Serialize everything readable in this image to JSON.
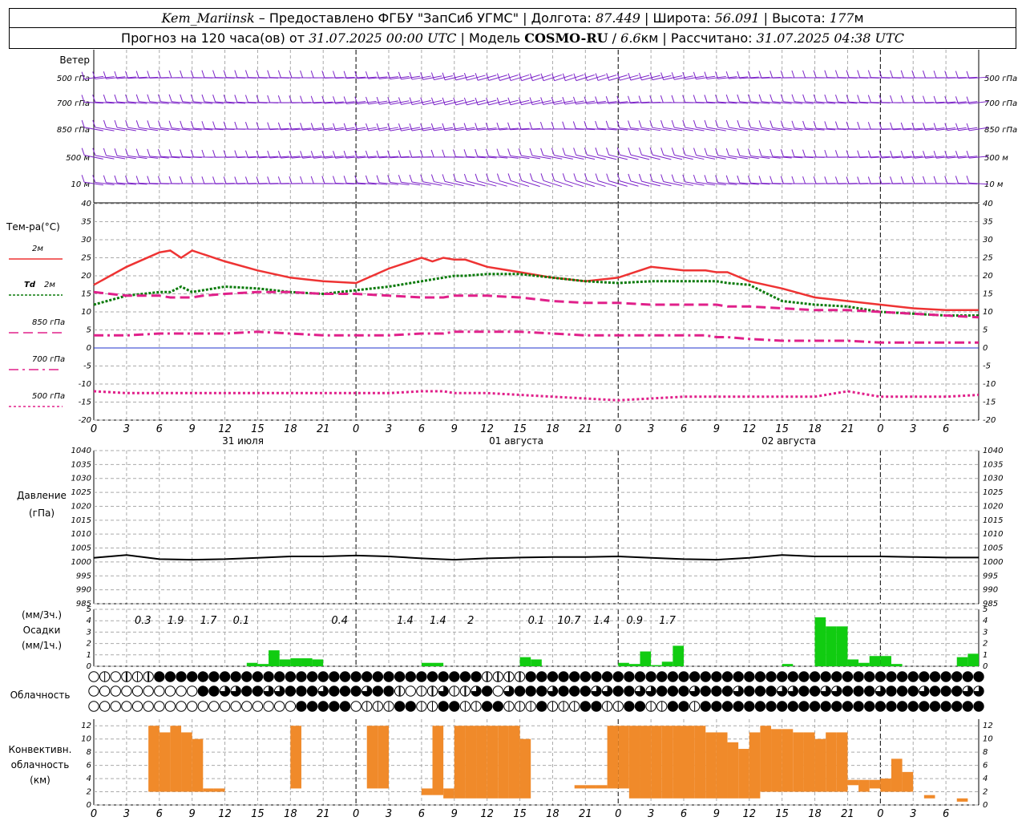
{
  "header": {
    "station": "Kem_Mariinsk",
    "dash": "–",
    "provider": "Предоставлено ФГБУ \"ЗапСиб УГМС\"",
    "lon_label": "Долгота:",
    "lon_value": "87.449",
    "lat_label": "Широта:",
    "lat_value": "56.091",
    "alt_label": "Высота:",
    "alt_value": "177",
    "alt_unit": "м",
    "forecast_prefix": "Прогноз на 120 часа(ов) от",
    "forecast_time": "31.07.2025 00:00 UTC",
    "model_label": "Модель",
    "model_name": "COSMO-RU",
    "model_res": "6.6",
    "model_res_unit": "км",
    "calc_label": "Рассчитано:",
    "calc_time": "31.07.2025 04:38 UTC"
  },
  "wind": {
    "title": "Ветер",
    "levels": [
      "500 гПа",
      "700 гПа",
      "850 гПа",
      "500 м",
      "10 м"
    ],
    "right_levels": [
      "500 гПа",
      "700 гПа",
      "850 гПа",
      "500 м",
      "10 м"
    ],
    "color": "#7b22c8"
  },
  "temperature": {
    "title": "Тем-ра(°C)",
    "legend": [
      {
        "label": "2м",
        "italic": "",
        "color": "#ee3333",
        "style": "solid"
      },
      {
        "label": "2м",
        "italic": "Td",
        "color": "#0a7a0a",
        "style": "dotted"
      },
      {
        "label": "850 гПа",
        "italic": "",
        "color": "#e0208a",
        "style": "dashed"
      },
      {
        "label": "700 гПа",
        "italic": "",
        "color": "#e0208a",
        "style": "dashdot"
      },
      {
        "label": "500 гПа",
        "italic": "",
        "color": "#e0208a",
        "style": "dot"
      }
    ],
    "y_ticks": [
      "40",
      "35",
      "30",
      "25",
      "20",
      "15",
      "10",
      "5",
      "0",
      "-5",
      "-10",
      "-15",
      "-20"
    ]
  },
  "time_axis": {
    "hour_labels": [
      "0",
      "3",
      "6",
      "9",
      "12",
      "15",
      "18",
      "21",
      "0",
      "3",
      "6",
      "9",
      "12",
      "15",
      "18",
      "21",
      "0",
      "3",
      "6",
      "9",
      "12",
      "15",
      "18",
      "21",
      "0",
      "3",
      "6"
    ],
    "dates": [
      "31 июля",
      "01 августа",
      "02 августа"
    ]
  },
  "pressure": {
    "title_line1": "Давление",
    "title_line2": "(гПа)",
    "y_ticks": [
      "1040",
      "1035",
      "1030",
      "1025",
      "1020",
      "1015",
      "1010",
      "1005",
      "1000",
      "995",
      "990",
      "985"
    ]
  },
  "precip": {
    "title_line1": "(мм/3ч.)",
    "title_line2": "Осадки",
    "title_line3": "(мм/1ч.)",
    "y_ticks": [
      "5",
      "4",
      "3",
      "2",
      "1",
      "0"
    ],
    "labels": [
      {
        "hour": 4.5,
        "text": "0.3"
      },
      {
        "hour": 7.5,
        "text": "1.9"
      },
      {
        "hour": 10.5,
        "text": "1.7"
      },
      {
        "hour": 13.5,
        "text": "0.1"
      },
      {
        "hour": 22.5,
        "text": "0.4"
      },
      {
        "hour": 28.5,
        "text": "1.4"
      },
      {
        "hour": 31.5,
        "text": "1.4"
      },
      {
        "hour": 34.5,
        "text": "2"
      },
      {
        "hour": 40.5,
        "text": "0.1"
      },
      {
        "hour": 43.5,
        "text": "10.7"
      },
      {
        "hour": 46.5,
        "text": "1.4"
      },
      {
        "hour": 49.5,
        "text": "0.9"
      },
      {
        "hour": 52.5,
        "text": "1.7"
      }
    ],
    "color": "#11cc11"
  },
  "cloudiness": {
    "title": "Облачность",
    "rows": 3
  },
  "convective": {
    "title_line1": "Конвективн.",
    "title_line2": "облачность",
    "title_line3": "(км)",
    "y_ticks": [
      "12",
      "10",
      "8",
      "6",
      "4",
      "2",
      "0"
    ],
    "color": "#f08a2a"
  },
  "chart_data": [
    {
      "type": "line",
      "title": "Тем-ра(°C)",
      "xlabel": "",
      "ylabel": "Тем-ра(°C)",
      "x_hours": [
        0,
        3,
        6,
        7,
        8,
        9,
        10,
        12,
        15,
        18,
        21,
        24,
        27,
        30,
        31,
        32,
        33,
        34,
        36,
        39,
        42,
        45,
        48,
        51,
        54,
        55,
        56,
        57,
        58,
        60,
        63,
        66,
        69,
        72,
        75,
        78,
        81
      ],
      "ylim": [
        -20,
        40
      ],
      "series": [
        {
          "name": "2м",
          "values": [
            17.5,
            22.5,
            26.5,
            27,
            25,
            27,
            26,
            24,
            21.5,
            19.5,
            18.5,
            18,
            22,
            25,
            24,
            25,
            24.5,
            24.5,
            22.5,
            21,
            19.5,
            18.5,
            19.5,
            22.5,
            21.5,
            21.5,
            21.5,
            21,
            21,
            18.5,
            16.5,
            14,
            13,
            12,
            11,
            10.5,
            10.5
          ]
        },
        {
          "name": "Td 2м",
          "values": [
            12,
            14.5,
            15.5,
            15.5,
            17,
            15.5,
            16,
            17,
            16.5,
            15.5,
            15,
            16,
            17,
            18.5,
            19,
            19.5,
            20,
            20,
            20.5,
            20.5,
            19.5,
            18.5,
            18,
            18.5,
            18.5,
            18.5,
            18.5,
            18.5,
            18,
            17.5,
            13,
            12,
            11.5,
            10,
            9.5,
            9,
            9
          ]
        },
        {
          "name": "850 гПа",
          "values": [
            15.5,
            14.5,
            14.5,
            14,
            14,
            14,
            14.5,
            15,
            15.5,
            15.5,
            15,
            15,
            14.5,
            14,
            14,
            14,
            14.5,
            14.5,
            14.5,
            14,
            13,
            12.5,
            12.5,
            12,
            12,
            12,
            12,
            12,
            11.5,
            11.5,
            11,
            10.5,
            10.5,
            10,
            9.5,
            9,
            8.5
          ]
        },
        {
          "name": "700 гПа",
          "values": [
            3.5,
            3.5,
            4,
            4,
            4,
            4,
            4,
            4,
            4.5,
            4,
            3.5,
            3.5,
            3.5,
            4,
            4,
            4,
            4.5,
            4.5,
            4.5,
            4.5,
            4,
            3.5,
            3.5,
            3.5,
            3.5,
            3.5,
            3.5,
            3,
            3,
            2.5,
            2,
            2,
            2,
            1.5,
            1.5,
            1.5,
            1.5
          ]
        },
        {
          "name": "500 гПа",
          "values": [
            -12,
            -12.5,
            -12.5,
            -12.5,
            -12.5,
            -12.5,
            -12.5,
            -12.5,
            -12.5,
            -12.5,
            -12.5,
            -12.5,
            -12.5,
            -12,
            -12,
            -12,
            -12.5,
            -12.5,
            -12.5,
            -13,
            -13.5,
            -14,
            -14.5,
            -14,
            -13.5,
            -13.5,
            -13.5,
            -13.5,
            -13.5,
            -13.5,
            -13.5,
            -13.5,
            -12,
            -13.5,
            -13.5,
            -13.5,
            -13
          ]
        }
      ]
    },
    {
      "type": "line",
      "title": "Давление (гПа)",
      "xlabel": "",
      "ylabel": "Давление (гПа)",
      "x_hours": [
        0,
        3,
        6,
        9,
        12,
        15,
        18,
        21,
        24,
        27,
        30,
        33,
        36,
        39,
        42,
        45,
        48,
        51,
        54,
        57,
        60,
        63,
        66,
        69,
        72,
        75,
        78,
        81
      ],
      "ylim": [
        985,
        1040
      ],
      "series": [
        {
          "name": "Давление",
          "values": [
            1001.5,
            1002.5,
            1001,
            1000.8,
            1001,
            1001.5,
            1002,
            1002,
            1002.3,
            1002,
            1001.3,
            1000.8,
            1001.3,
            1001.6,
            1001.8,
            1001.8,
            1002,
            1001.5,
            1001,
            1000.8,
            1001.5,
            1002.5,
            1002,
            1002,
            1002,
            1001.8,
            1001.6,
            1001.6
          ]
        }
      ]
    },
    {
      "type": "bar",
      "title": "Осадки (мм/1ч.)",
      "xlabel": "",
      "ylabel": "Осадки",
      "ylim": [
        0,
        5
      ],
      "x_hours": [
        15,
        16,
        17,
        18,
        19,
        20,
        21,
        22,
        23,
        31,
        32,
        40,
        41,
        49,
        50,
        51,
        52,
        53,
        54,
        55,
        56,
        57,
        64,
        65,
        66,
        67,
        68,
        69,
        70,
        71,
        72,
        73,
        74,
        75,
        76,
        77,
        80,
        81
      ],
      "values": [
        0.3,
        0.2,
        1.4,
        0.6,
        0.7,
        0.7,
        0.6,
        0,
        0,
        0.3,
        0.3,
        0.8,
        0.6,
        0.3,
        0.2,
        1.3,
        0.1,
        0.4,
        1.8,
        0,
        0,
        0,
        0.2,
        0,
        0,
        4.3,
        3.5,
        3.5,
        0.6,
        0.3,
        0.9,
        0.9,
        0.2,
        0,
        0,
        0,
        0.8,
        1.1
      ]
    },
    {
      "type": "bar",
      "title": "Конвективн. облачность (км)",
      "xlabel": "",
      "ylabel": "(км)",
      "ylim": [
        0,
        13
      ],
      "x_hours": [
        6,
        7,
        8,
        9,
        10,
        11,
        12,
        13,
        16,
        17,
        19,
        22,
        23,
        24,
        25,
        26,
        27,
        29,
        30,
        31,
        32,
        33,
        34,
        35,
        36,
        37,
        38,
        39,
        40,
        44,
        45,
        46,
        47,
        48,
        49,
        50,
        51,
        52,
        53,
        54,
        55,
        56,
        57,
        58,
        59,
        60,
        61,
        62,
        63,
        64,
        65,
        66,
        67,
        68,
        69,
        70,
        71,
        72,
        73,
        74,
        75,
        76,
        77,
        78,
        79,
        80
      ],
      "bottom": [
        2,
        2,
        2,
        2,
        2,
        2,
        2,
        2.5,
        2.5,
        2.5,
        2.5,
        2.5,
        2.5,
        2.5,
        2.5,
        2.5,
        2.5,
        2.5,
        2.5,
        1.5,
        1.5,
        1,
        1,
        1,
        1,
        1,
        1,
        1,
        1,
        2.5,
        2.5,
        2.5,
        2.5,
        2.5,
        2.5,
        1,
        1,
        1,
        1,
        1,
        1,
        1,
        1,
        1,
        1,
        1,
        1,
        2,
        2,
        2,
        2,
        2,
        2,
        2,
        2,
        3,
        2,
        2.5,
        2,
        2,
        2,
        1.5,
        1,
        1,
        1,
        0.5
      ],
      "top": [
        12,
        11,
        12,
        11,
        10,
        2.5,
        2.5,
        2.5,
        2.5,
        2.5,
        12,
        2.5,
        2.5,
        2.5,
        2.5,
        12,
        12,
        2.5,
        2.5,
        2.5,
        12,
        2.5,
        12,
        12,
        12,
        12,
        12,
        12,
        10,
        2.5,
        3,
        3,
        3,
        12,
        12,
        12,
        12,
        12,
        12,
        12,
        12,
        12,
        11,
        11,
        9.5,
        8.5,
        11,
        12,
        11.5,
        11.5,
        11,
        11,
        10,
        11,
        11,
        3.8,
        3.8,
        3.8,
        4,
        7,
        5,
        1.5,
        1.5,
        1,
        1,
        1
      ]
    }
  ]
}
